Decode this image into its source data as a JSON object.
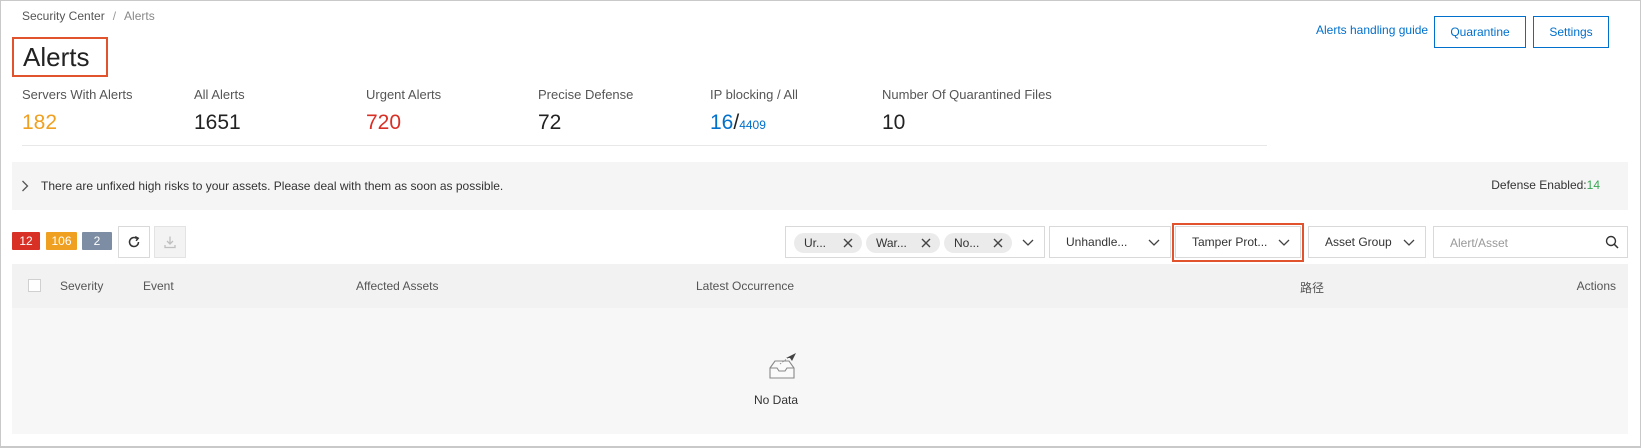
{
  "breadcrumb": {
    "root": "Security Center",
    "separator": "/",
    "current": "Alerts"
  },
  "page": {
    "title": "Alerts"
  },
  "header": {
    "guide_link": "Alerts handling guide",
    "quarantine_button": "Quarantine",
    "settings_button": "Settings"
  },
  "stats": [
    {
      "label": "Servers With Alerts",
      "value": "182",
      "color": "#f0a020"
    },
    {
      "label": "All Alerts",
      "value": "1651",
      "color": "#222222"
    },
    {
      "label": "Urgent Alerts",
      "value": "720",
      "color": "#d93026"
    },
    {
      "label": "Precise Defense",
      "value": "72",
      "color": "#222222"
    },
    {
      "label": "IP blocking / All",
      "value": "16",
      "separator": "/",
      "total": "4409",
      "color": "#0070cc"
    },
    {
      "label": "Number Of Quarantined Files",
      "value": "10",
      "color": "#222222"
    }
  ],
  "banner": {
    "message": "There are unfixed high risks to your assets. Please deal with them as soon as possible.",
    "defense_label": "Defense Enabled:",
    "defense_value": "14"
  },
  "toolbar": {
    "badges": [
      {
        "value": "12",
        "color": "#d93026"
      },
      {
        "value": "106",
        "color": "#f0a020"
      },
      {
        "value": "2",
        "color": "#7d8da3"
      }
    ],
    "severity_tags": [
      "Ur...",
      "War...",
      "No..."
    ],
    "status_select": "Unhandle...",
    "type_select": "Tamper Prot...",
    "group_select": "Asset Group",
    "search_placeholder": "Alert/Asset"
  },
  "table": {
    "columns": [
      "Severity",
      "Event",
      "Affected Assets",
      "Latest Occurrence",
      "路径",
      "Actions"
    ],
    "empty_text": "No Data"
  },
  "icons": [
    "chevron-right-icon",
    "refresh-icon",
    "download-icon",
    "close-icon",
    "chevron-down-icon",
    "search-icon",
    "empty-inbox-icon"
  ],
  "accent_color": "#0070cc",
  "highlight_color": "#e0532d"
}
